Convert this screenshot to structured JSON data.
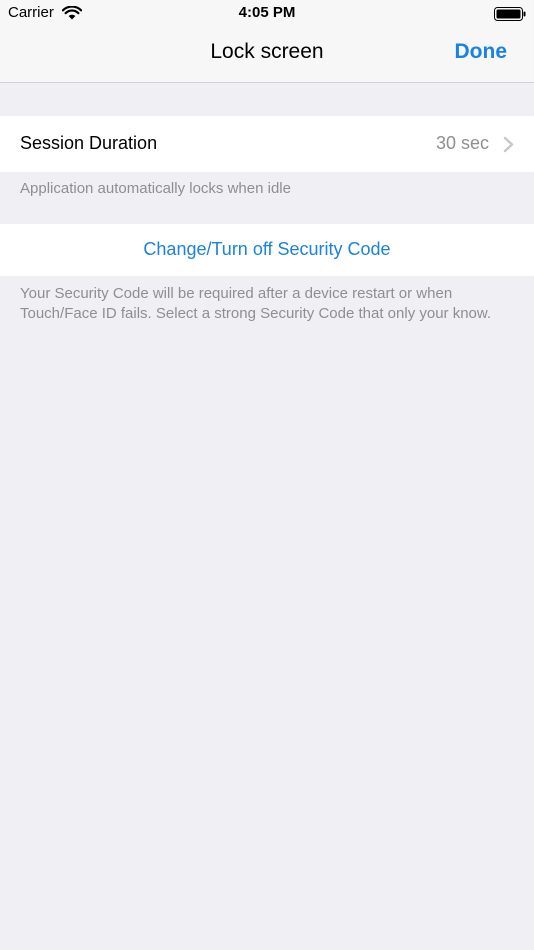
{
  "status_bar": {
    "carrier": "Carrier",
    "time": "4:05 PM"
  },
  "nav": {
    "title": "Lock screen",
    "done_label": "Done"
  },
  "session": {
    "label": "Session Duration",
    "value": "30 sec",
    "footer": "Application automatically locks when idle"
  },
  "security": {
    "action_label": "Change/Turn off Security Code",
    "footer": "Your Security Code will be required after a device restart or when Touch/Face ID fails. Select a strong Security Code that only your know."
  },
  "icons": {
    "wifi": "wifi-icon",
    "battery": "battery-icon",
    "chevron": "chevron-right-icon"
  },
  "colors": {
    "accent": "#1a82e2",
    "background": "#efeff4",
    "secondary_text": "#8e8e93"
  }
}
